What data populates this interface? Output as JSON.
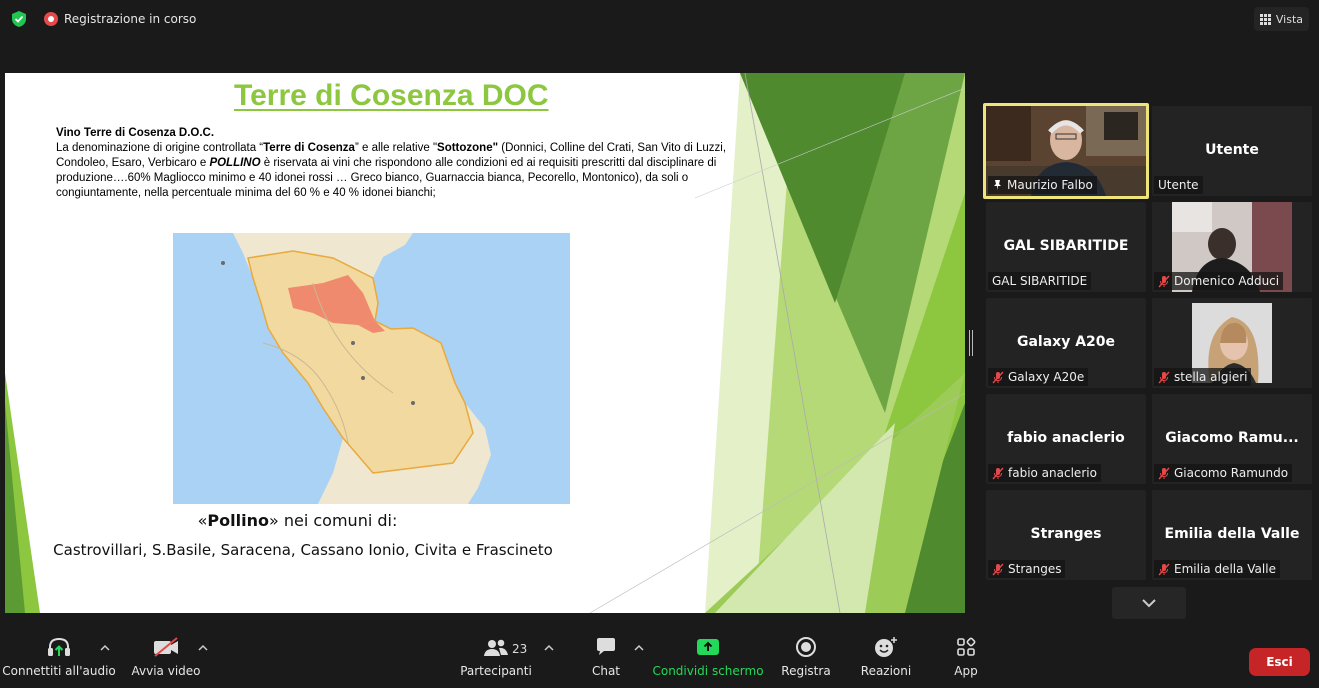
{
  "topbar": {
    "recording": "Registrazione in corso",
    "view_label": "Vista"
  },
  "slide": {
    "title": "Terre di Cosenza DOC",
    "heading": "Vino Terre di Cosenza D.O.C.",
    "body_1": "La denominazione di origine controllata “",
    "body_b1": "Terre di Cosenza",
    "body_2": "” e alle relative \"",
    "body_b2": "Sottozone\"",
    "body_3": " (Donnici, Colline del Crati, San Vito di Luzzi, Condoleo, Esaro, Verbicaro e ",
    "body_b3": "POLLINO",
    "body_4": " è riservata ai vini che rispondono alle condizioni ed ai requisiti prescritti dal disciplinare di produzione….60% Magliocco minimo e 40 idonei rossi … Greco bianco, Guarnaccia bianca, Pecorello, Montonico), da soli o congiuntamente, nella percentuale minima del 60 % e 40 % idonei bianchi;",
    "caption_open": "«",
    "caption_bold": "Pollino",
    "caption_rest": "» nei comuni di:",
    "comuni": "Castrovillari, S.Basile, Saracena, Cassano Ionio, Civita e Frascineto"
  },
  "participants": [
    {
      "label": "Maurizio Falbo",
      "pinned": true,
      "video": true
    },
    {
      "label": "Utente",
      "name": "Utente"
    },
    {
      "label": "GAL SIBARITIDE",
      "name": "GAL SIBARITIDE"
    },
    {
      "label": "Domenico Adduci",
      "muted": true,
      "video": true
    },
    {
      "label": "Galaxy A20e",
      "name": "Galaxy A20e",
      "muted": true
    },
    {
      "label": "stella algieri",
      "muted": true,
      "video": true
    },
    {
      "label": "fabio anaclerio",
      "name": "fabio anaclerio",
      "muted": true
    },
    {
      "label": "Giacomo Ramundo",
      "name": "Giacomo  Ramu...",
      "muted": true
    },
    {
      "label": "Stranges",
      "name": "Stranges",
      "muted": true
    },
    {
      "label": "Emilia della Valle",
      "name": "Emilia della Valle",
      "muted": true
    }
  ],
  "toolbar": {
    "audio": "Connettiti all'audio",
    "video": "Avvia video",
    "participants": "Partecipanti",
    "participants_count": "23",
    "chat": "Chat",
    "share": "Condividi schermo",
    "record": "Registra",
    "reactions": "Reazioni",
    "apps": "App",
    "leave": "Esci"
  },
  "colors": {
    "slide_green": "#8dc63f",
    "share_green": "#23d959",
    "leave_red": "#c52527",
    "active_speaker": "#ede57a"
  }
}
